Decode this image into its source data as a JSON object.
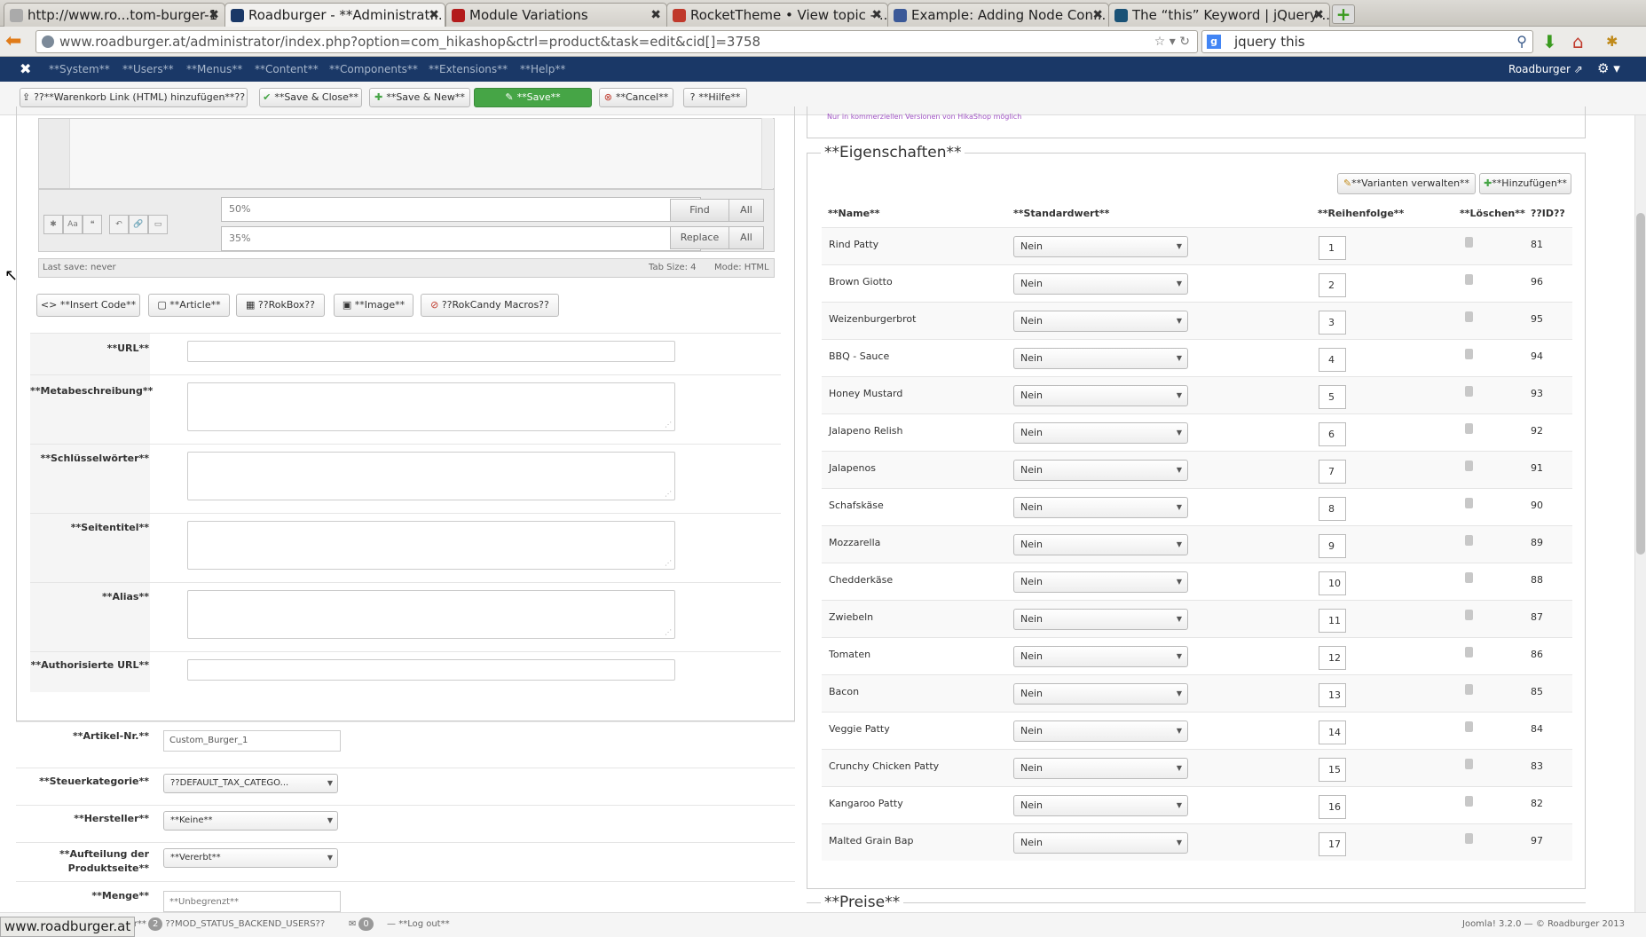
{
  "browser": {
    "tabs": [
      {
        "label": "http://www.ro...tom-burger-1"
      },
      {
        "label": "Roadburger - **Administrat..."
      },
      {
        "label": "Module Variations"
      },
      {
        "label": "RocketTheme • View topic - ..."
      },
      {
        "label": "Example: Adding Node Con..."
      },
      {
        "label": "The “this” Keyword | jQuery ..."
      }
    ],
    "url": "www.roadburger.at/administrator/index.php?option=com_hikashop&ctrl=product&task=edit&cid[]=3758",
    "search": "jquery this",
    "status_url": "www.roadburger.at"
  },
  "joomla": {
    "menu": [
      "**System**",
      "**Users**",
      "**Menus**",
      "**Content**",
      "**Components**",
      "**Extensions**",
      "**Help**"
    ],
    "site_link": "Roadburger ⇗"
  },
  "toolbar": {
    "cart_link": "??**Warenkorb Link (HTML) hinzufügen**??",
    "save_close": "**Save & Close**",
    "save_new": "**Save & New**",
    "save": "**Save**",
    "cancel": "**Cancel**",
    "help": "**Hilfe**"
  },
  "editor": {
    "find_value": "50%",
    "replace_value": "35%",
    "find": "Find",
    "replace": "Replace",
    "all": "All",
    "last_save": "Last save: never",
    "tab_size": "Tab Size: 4",
    "mode": "Mode: HTML",
    "buttons": {
      "insert_code": "**Insert Code**",
      "article": "**Article**",
      "rokbox": "??RokBox??",
      "image": "**Image**",
      "rokcandy": "??RokCandy Macros??"
    }
  },
  "meta_fields": {
    "url": "**URL**",
    "metabeschreibung": "**Metabeschreibung**",
    "schluesselwoerter": "**Schlüsselwörter**",
    "seitentitel": "**Seitentitel**",
    "alias": "**Alias**",
    "authorisierte_url": "**Authorisierte URL**"
  },
  "product_fields": {
    "artikel_nr_label": "**Artikel-Nr.**",
    "artikel_nr_value": "Custom_Burger_1",
    "steuer_label": "**Steuerkategorie**",
    "steuer_value": "??DEFAULT_TAX_CATEGO...",
    "hersteller_label": "**Hersteller**",
    "hersteller_value": "**Keine**",
    "aufteilung_label_1": "**Aufteilung der",
    "aufteilung_label_2": "Produktseite**",
    "aufteilung_value": "**Vererbt**",
    "menge_label": "**Menge**",
    "menge_placeholder": "**Unbegrenzt**"
  },
  "properties": {
    "note": "Nur in kommerziellen Versionen von HikaShop möglich",
    "title": "**Eigenschaften**",
    "manage_variants": "**Varianten verwalten**",
    "add": "**Hinzufügen**",
    "columns": {
      "name": "**Name**",
      "default": "**Standardwert**",
      "order": "**Reihenfolge**",
      "delete": "**Löschen**",
      "id": "??ID??"
    },
    "rows": [
      {
        "name": "Rind Patty",
        "default": "Nein",
        "order": "1",
        "id": "81"
      },
      {
        "name": "Brown Giotto",
        "default": "Nein",
        "order": "2",
        "id": "96"
      },
      {
        "name": "Weizenburgerbrot",
        "default": "Nein",
        "order": "3",
        "id": "95"
      },
      {
        "name": "BBQ - Sauce",
        "default": "Nein",
        "order": "4",
        "id": "94"
      },
      {
        "name": "Honey Mustard",
        "default": "Nein",
        "order": "5",
        "id": "93"
      },
      {
        "name": "Jalapeno Relish",
        "default": "Nein",
        "order": "6",
        "id": "92"
      },
      {
        "name": "Jalapenos",
        "default": "Nein",
        "order": "7",
        "id": "91"
      },
      {
        "name": "Schafskäse",
        "default": "Nein",
        "order": "8",
        "id": "90"
      },
      {
        "name": "Mozzarella",
        "default": "Nein",
        "order": "9",
        "id": "89"
      },
      {
        "name": "Chedderkäse",
        "default": "Nein",
        "order": "10",
        "id": "88"
      },
      {
        "name": "Zwiebeln",
        "default": "Nein",
        "order": "11",
        "id": "87"
      },
      {
        "name": "Tomaten",
        "default": "Nein",
        "order": "12",
        "id": "86"
      },
      {
        "name": "Bacon",
        "default": "Nein",
        "order": "13",
        "id": "85"
      },
      {
        "name": "Veggie Patty",
        "default": "Nein",
        "order": "14",
        "id": "84"
      },
      {
        "name": "Crunchy Chicken Patty",
        "default": "Nein",
        "order": "15",
        "id": "83"
      },
      {
        "name": "Kangaroo Patty",
        "default": "Nein",
        "order": "16",
        "id": "82"
      },
      {
        "name": "Malted Grain Bap",
        "default": "Nein",
        "order": "17",
        "id": "97"
      }
    ]
  },
  "preise_title": "**Preise**",
  "statusbar": {
    "editor_fragment": "itor**",
    "users_count": "2",
    "users_label": "??MOD_STATUS_BACKEND_USERS??",
    "messages_count": "0",
    "logout": "**Log out**",
    "copyright": "Joomla! 3.2.0 — © Roadburger 2013"
  }
}
